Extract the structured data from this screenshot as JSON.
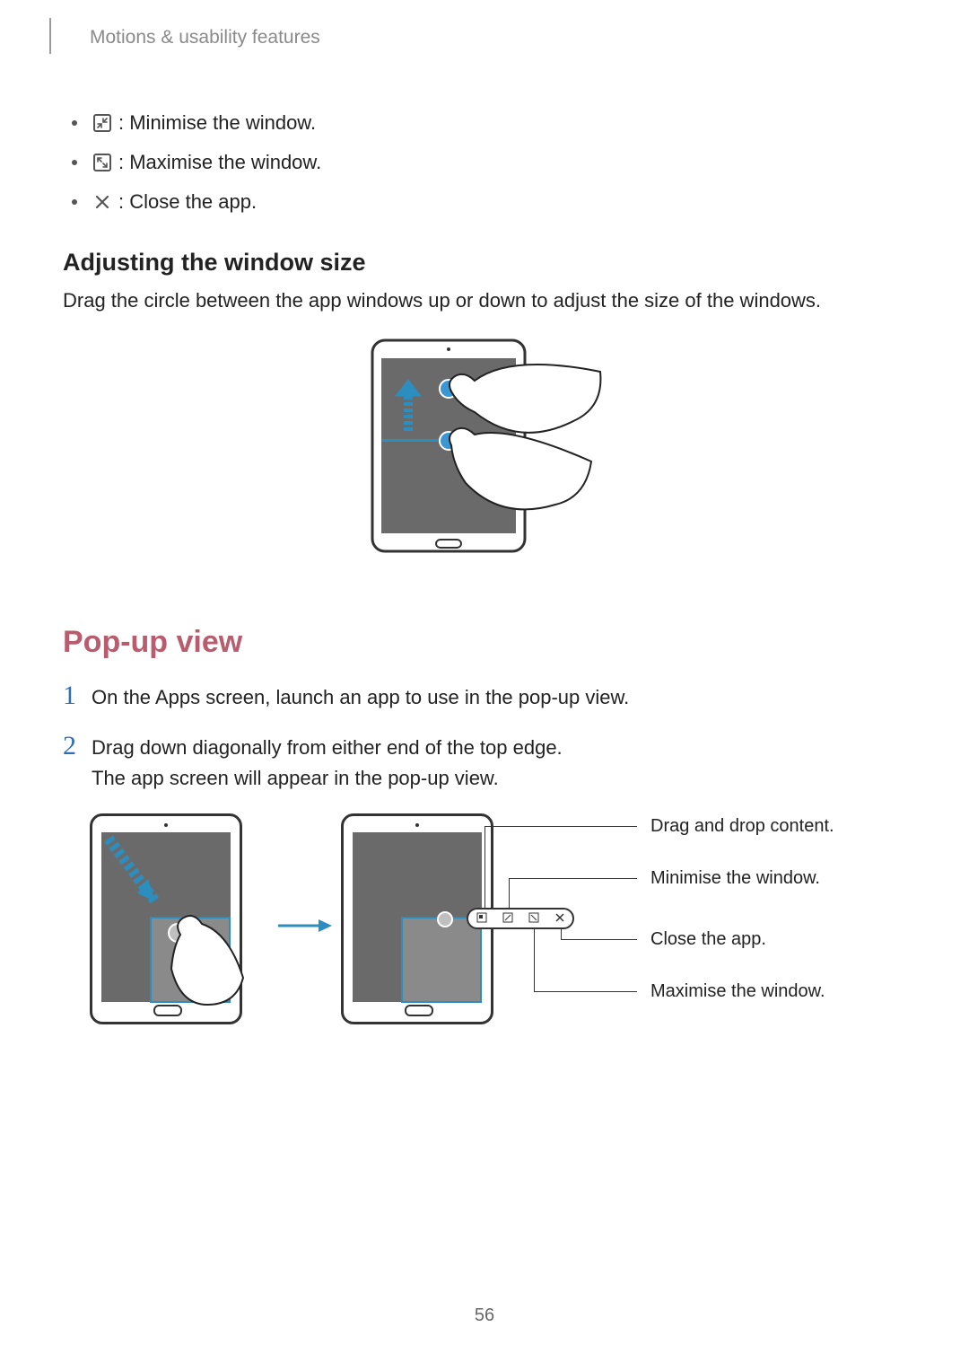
{
  "running_head": "Motions & usability features",
  "icon_list": [
    {
      "icon": "minimise-icon",
      "text": ": Minimise the window."
    },
    {
      "icon": "maximise-icon",
      "text": ": Maximise the window."
    },
    {
      "icon": "close-icon",
      "text": ": Close the app."
    }
  ],
  "adjust": {
    "heading": "Adjusting the window size",
    "body": "Drag the circle between the app windows up or down to adjust the size of the windows."
  },
  "section_heading": "Pop-up view",
  "steps": [
    {
      "num": "1",
      "lines": [
        "On the Apps screen, launch an app to use in the pop-up view."
      ]
    },
    {
      "num": "2",
      "lines": [
        "Drag down diagonally from either end of the top edge.",
        "The app screen will appear in the pop-up view."
      ]
    }
  ],
  "callouts": {
    "drag": "Drag and drop content.",
    "min": "Minimise the window.",
    "close": "Close the app.",
    "max": "Maximise the window."
  },
  "page_number": "56"
}
